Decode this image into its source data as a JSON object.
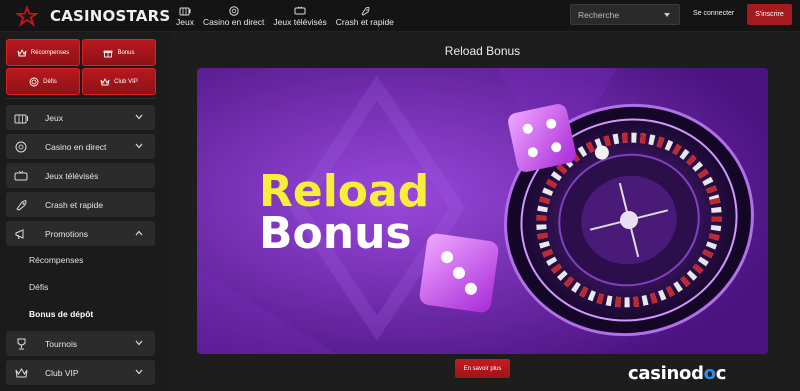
{
  "brand": {
    "name": "CASINOSTARS",
    "accent": "#a41a1f"
  },
  "topnav": [
    {
      "label": "Jeux",
      "icon": "slot-machine-icon"
    },
    {
      "label": "Casino en direct",
      "icon": "chip-icon"
    },
    {
      "label": "Jeux télévisés",
      "icon": "tv-icon"
    },
    {
      "label": "Crash et rapide",
      "icon": "rocket-icon"
    }
  ],
  "search": {
    "placeholder": "Recherche"
  },
  "auth": {
    "login": "Se connecter",
    "signup": "S'inscrire"
  },
  "quick_links": [
    {
      "label": "Récompenses",
      "icon": "crown-icon"
    },
    {
      "label": "Bonus",
      "icon": "gift-icon"
    },
    {
      "label": "Défis",
      "icon": "target-icon"
    },
    {
      "label": "Club VIP",
      "icon": "vip-crown-icon"
    }
  ],
  "sidebar": {
    "items": [
      {
        "label": "Jeux",
        "icon": "slot-machine-icon",
        "chevron": "down"
      },
      {
        "label": "Casino en direct",
        "icon": "chip-icon",
        "chevron": "down"
      },
      {
        "label": "Jeux télévisés",
        "icon": "tv-icon",
        "chevron": ""
      },
      {
        "label": "Crash et rapide",
        "icon": "rocket-icon",
        "chevron": ""
      },
      {
        "label": "Promotions",
        "icon": "megaphone-icon",
        "chevron": "up"
      },
      {
        "label": "Tournois",
        "icon": "trophy-icon",
        "chevron": "down"
      },
      {
        "label": "Club VIP",
        "icon": "vip-crown-icon",
        "chevron": "down"
      }
    ],
    "promotions_sub": [
      "Récompenses",
      "Défis",
      "Bonus de dépôt"
    ]
  },
  "main": {
    "title": "Reload Bonus",
    "banner": {
      "line1": "Reload",
      "line2": "Bonus"
    },
    "cta": "En savoir plus",
    "watermark_pre": "casinod",
    "watermark_o": "o",
    "watermark_post": "c"
  }
}
